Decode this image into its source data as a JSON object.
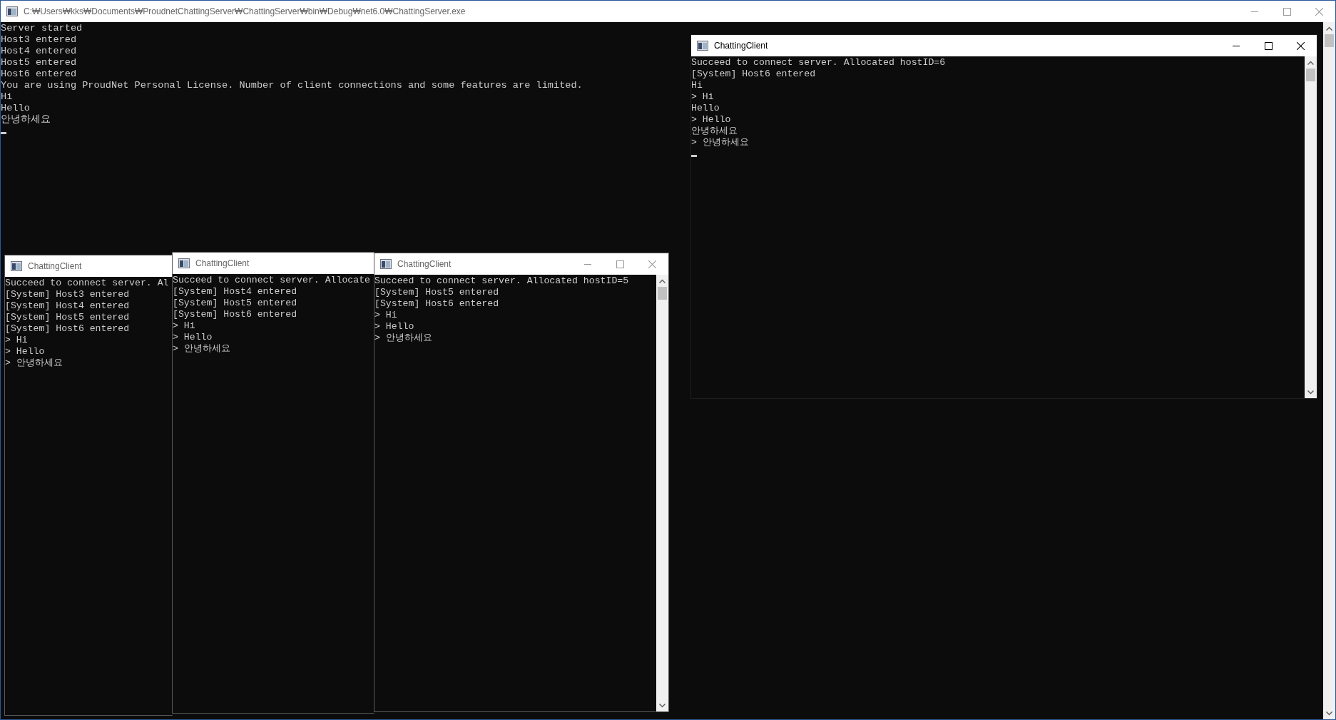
{
  "console": {
    "title": "C:₩Users₩kks₩Documents₩ProudnetChattingServer₩ChattingServer₩bin₩Debug₩net6.0₩ChattingServer.exe",
    "active": false,
    "controls": true,
    "scrollbar": true,
    "cursor": true,
    "lines": [
      "Server started",
      "Host3 entered",
      "Host4 entered",
      "Host5 entered",
      "Host6 entered",
      "You are using ProudNet Personal License. Number of client connections and some features are limited.",
      "Hi",
      "Hello",
      "안녕하세요"
    ]
  },
  "client_windows": [
    {
      "title": "ChattingClient",
      "active": true,
      "controls": true,
      "scrollbar": true,
      "cursor": true,
      "lines": [
        "Succeed to connect server. Allocated hostID=6",
        "[System] Host6 entered",
        "Hi",
        "> Hi",
        "Hello",
        "> Hello",
        "안녕하세요",
        "> 안녕하세요"
      ]
    },
    {
      "title": "ChattingClient",
      "active": false,
      "controls": false,
      "scrollbar": false,
      "cursor": false,
      "lines": [
        "Succeed to connect server. Al",
        "[System] Host3 entered",
        "[System] Host4 entered",
        "[System] Host5 entered",
        "[System] Host6 entered",
        "> Hi",
        "> Hello",
        "> 안녕하세요"
      ]
    },
    {
      "title": "ChattingClient",
      "active": false,
      "controls": false,
      "scrollbar": false,
      "cursor": false,
      "lines": [
        "Succeed to connect server. Allocate",
        "[System] Host4 entered",
        "[System] Host5 entered",
        "[System] Host6 entered",
        "> Hi",
        "> Hello",
        "> 안녕하세요"
      ]
    },
    {
      "title": "ChattingClient",
      "active": false,
      "controls": true,
      "scrollbar": true,
      "cursor": false,
      "lines": [
        "Succeed to connect server. Allocated hostID=5",
        "[System] Host5 entered",
        "[System] Host6 entered",
        "> Hi",
        "> Hello",
        "> 안녕하세요"
      ]
    }
  ]
}
